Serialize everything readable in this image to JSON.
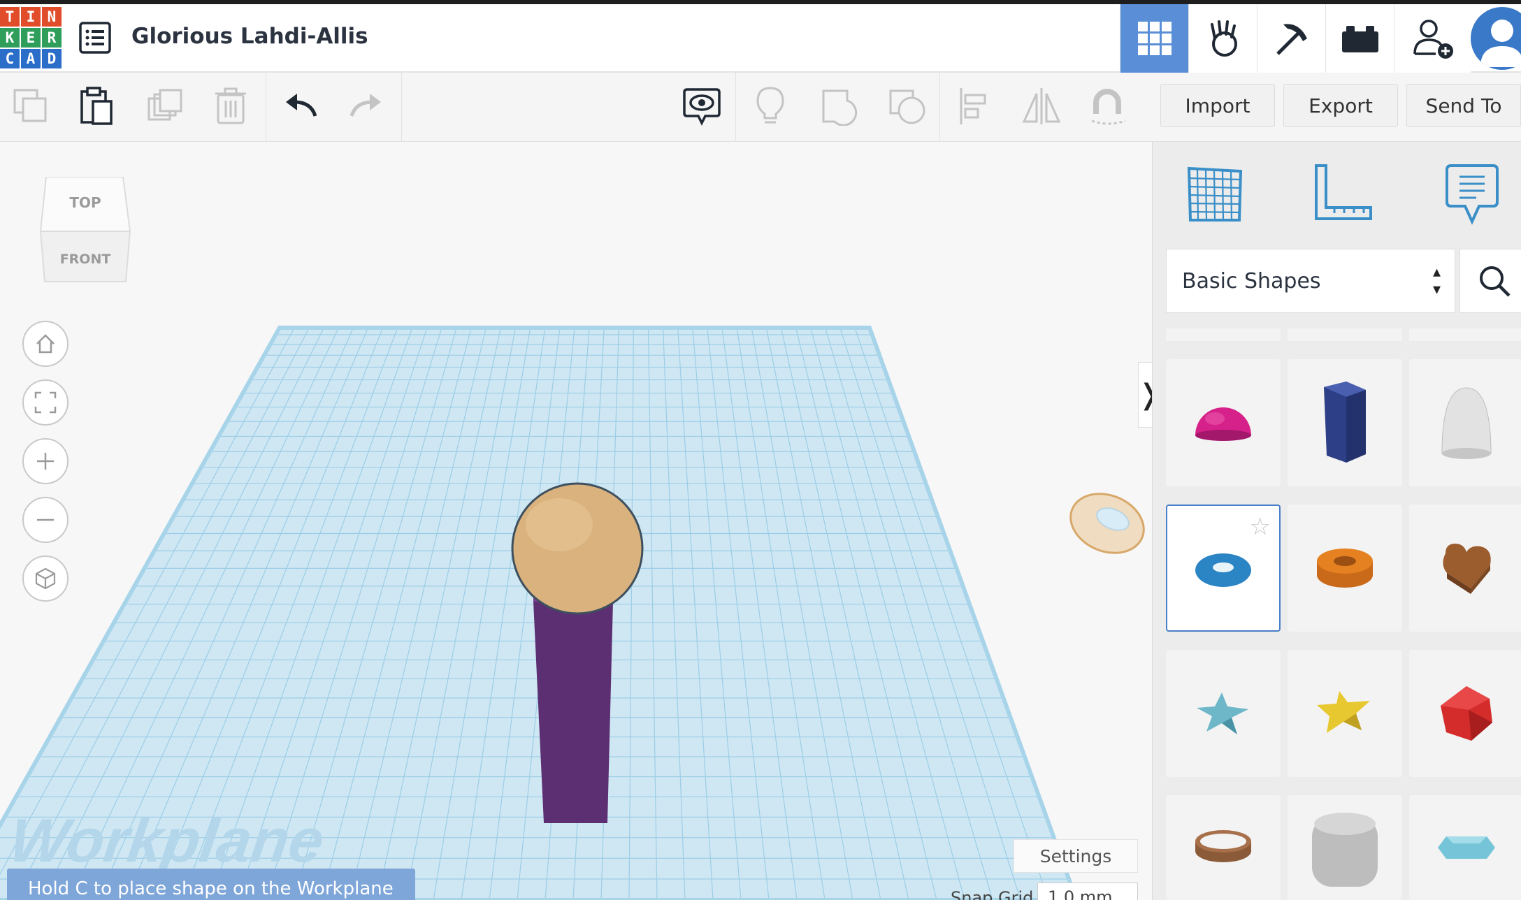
{
  "app": {
    "logo_letters": [
      "T",
      "I",
      "N",
      "K",
      "E",
      "R",
      "C",
      "A",
      "D"
    ],
    "logo_colors": [
      "#e14d2a",
      "#e14d2a",
      "#e14d2a",
      "#2f9e5a",
      "#2f9e5a",
      "#2f9e5a",
      "#2a6ec9",
      "#2a6ec9",
      "#2a6ec9"
    ],
    "design_title": "Glorious Lahdi-Allis"
  },
  "header": {
    "buttons": [
      {
        "name": "3d-design-view",
        "icon": "grid-icon",
        "active": true
      },
      {
        "name": "sim-lab",
        "icon": "hand-apple-icon",
        "active": false
      },
      {
        "name": "minecraft",
        "icon": "pickaxe-icon",
        "active": false
      },
      {
        "name": "lego-bricks",
        "icon": "brick-icon",
        "active": false
      },
      {
        "name": "invite-user",
        "icon": "add-user-icon",
        "active": false
      }
    ],
    "accent": "#5a8fd8"
  },
  "toolbar": {
    "import_label": "Import",
    "export_label": "Export",
    "send_to_label": "Send To"
  },
  "viewport": {
    "viewcube_top": "TOP",
    "viewcube_front": "FRONT",
    "workplane_label": "Workplane",
    "settings_label": "Settings",
    "snap_grid_label": "Snap Grid",
    "snap_grid_value": "1.0 mm",
    "hint": "Hold C to place shape on the Workplane"
  },
  "panel": {
    "category": "Basic Shapes",
    "shapes": [
      {
        "name": "half-sphere",
        "color": "#d6218a"
      },
      {
        "name": "polygon",
        "color": "#2d3f86"
      },
      {
        "name": "paraboloid",
        "color": "#d8d8d8"
      },
      {
        "name": "torus",
        "color": "#2b84c4",
        "selected": true
      },
      {
        "name": "tube",
        "color": "#e58120"
      },
      {
        "name": "heart",
        "color": "#9b5c2e"
      },
      {
        "name": "star",
        "color": "#6db7c9"
      },
      {
        "name": "star-yellow",
        "color": "#e8c830"
      },
      {
        "name": "icosahedron",
        "color": "#d42b2b"
      },
      {
        "name": "ring",
        "color": "#8b5a38"
      },
      {
        "name": "round-box",
        "color": "#bdbdbd"
      },
      {
        "name": "gem",
        "color": "#75c4d8"
      }
    ]
  }
}
